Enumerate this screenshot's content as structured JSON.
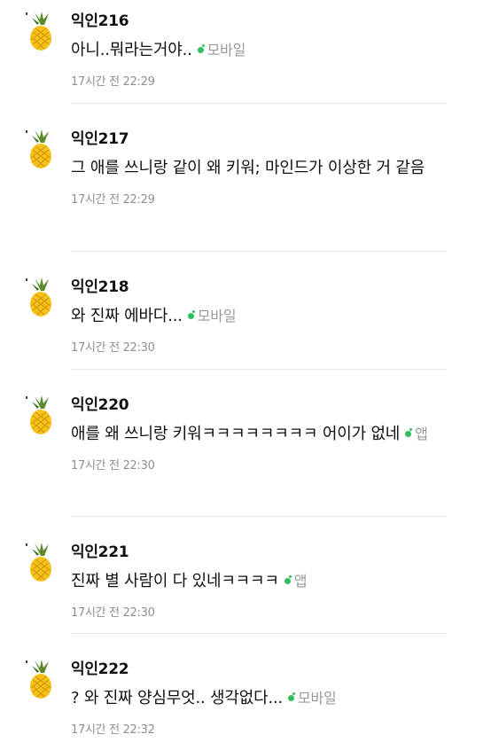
{
  "colors": {
    "online_dot": "#2fbf5b",
    "muted_text": "#9a9a9a",
    "divider": "#e6e6e6"
  },
  "avatar_icon": "pineapple-icon",
  "comments": [
    {
      "author": "익인216",
      "text": "아니..뭐라는거야..",
      "device": "모바일",
      "time": "17시간 전 22:29"
    },
    {
      "author": "익인217",
      "text": "그 애를 쓰니랑 같이 왜 키워; 마인드가 이상한 거 같음",
      "device": "",
      "time": "17시간 전 22:29"
    },
    {
      "author": "익인218",
      "text": "와 진짜 에바다...",
      "device": "모바일",
      "time": "17시간 전 22:30"
    },
    {
      "author": "익인220",
      "text": "애를 왜 쓰니랑 키워ㅋㅋㅋㅋㅋㅋㅋㅋ 어이가 없네",
      "device": "앱",
      "time": "17시간 전 22:30"
    },
    {
      "author": "익인221",
      "text": "진짜 별 사람이 다 있네ㅋㅋㅋㅋ",
      "device": "앱",
      "time": "17시간 전 22:30"
    },
    {
      "author": "익인222",
      "text": "? 와 진짜 양심무엇.. 생각없다...",
      "device": "모바일",
      "time": "17시간 전 22:32"
    }
  ]
}
